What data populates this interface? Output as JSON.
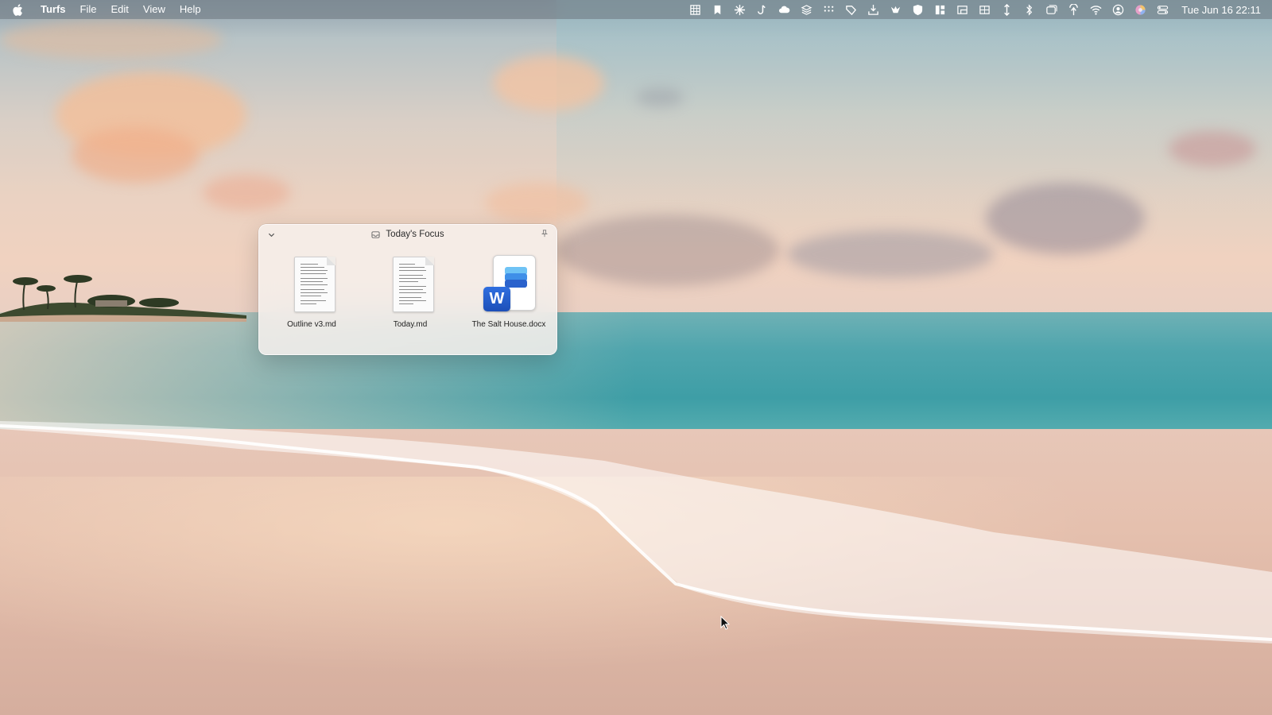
{
  "menubar": {
    "app_name": "Turfs",
    "menus": [
      "File",
      "Edit",
      "View",
      "Help"
    ],
    "status_icons": [
      "grid-icon",
      "bookmark-icon",
      "sparkle-icon",
      "hook-icon",
      "cloud-icon",
      "layers-icon",
      "dots-grid-icon",
      "tag-icon",
      "download-tray-icon",
      "crown-icon",
      "shield-icon",
      "tiles-icon",
      "window-corner-icon",
      "split-window-icon",
      "up-down-arrow-icon",
      "bluetooth-icon",
      "screens-icon",
      "antenna-icon",
      "wifi-icon",
      "user-circle-icon",
      "color-wheel-icon",
      "control-center-icon"
    ],
    "clock": "Tue Jun 16  22:11"
  },
  "shelf": {
    "title": "Today's Focus",
    "files": [
      {
        "name": "Outline v3.md",
        "kind": "text"
      },
      {
        "name": "Today.md",
        "kind": "text"
      },
      {
        "name": "The Salt House.docx",
        "kind": "word"
      }
    ],
    "word_badge_letter": "W"
  },
  "colors": {
    "menubar_bg": "#6e767e",
    "word_blue": "#1d4fb8",
    "sea": "#3e9ea6",
    "sand": "#e5c0ae"
  }
}
